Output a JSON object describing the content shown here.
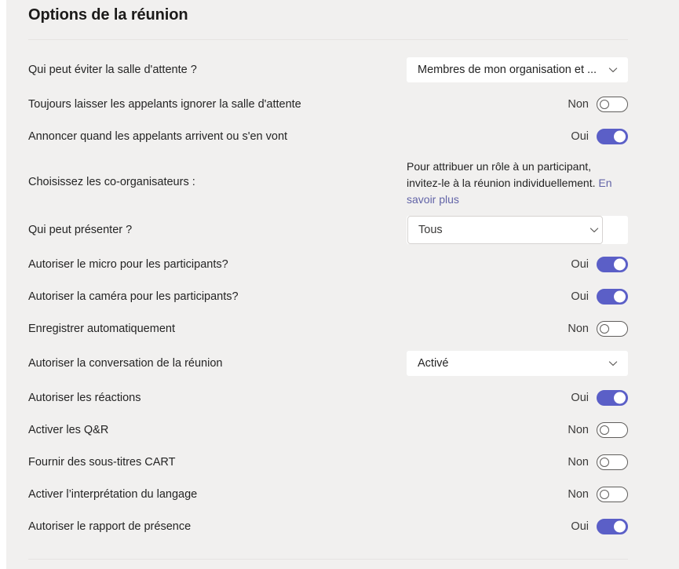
{
  "header": {
    "title": "Options de la réunion"
  },
  "rows": [
    {
      "id": "bypass-lobby",
      "label": "Qui peut éviter la salle d'attente ?",
      "control": "dropdown-flat",
      "value": "Membres de mon organisation et ...",
      "icon": "chevron-down-icon"
    },
    {
      "id": "always-let-callers-bypass",
      "label": "Toujours laisser les appelants ignorer la salle d'attente",
      "control": "toggle",
      "state": "Non",
      "on": false
    },
    {
      "id": "announce-callers",
      "label": "Annoncer quand les appelants arrivent ou s'en vont",
      "control": "toggle",
      "state": "Oui",
      "on": true
    },
    {
      "id": "choose-co-organizers",
      "label": "Choisissez les co-organisateurs :",
      "control": "info",
      "info_text": "Pour attribuer un rôle à un participant, invitez-le à la réunion individuellement. ",
      "info_link": "En savoir plus"
    },
    {
      "id": "who-can-present",
      "label": "Qui peut présenter ?",
      "control": "dropdown-bordered",
      "value": "Tous",
      "icon": "chevron-down-icon"
    },
    {
      "id": "allow-mic",
      "label": "Autoriser le micro pour les participants?",
      "control": "toggle",
      "state": "Oui",
      "on": true
    },
    {
      "id": "allow-camera",
      "label": "Autoriser la caméra pour les participants?",
      "control": "toggle",
      "state": "Oui",
      "on": true
    },
    {
      "id": "record-automatically",
      "label": "Enregistrer automatiquement",
      "control": "toggle",
      "state": "Non",
      "on": false
    },
    {
      "id": "allow-meeting-chat",
      "label": "Autoriser la conversation de la réunion",
      "control": "dropdown-flat",
      "value": "Activé",
      "icon": "chevron-down-icon"
    },
    {
      "id": "allow-reactions",
      "label": "Autoriser les réactions",
      "control": "toggle",
      "state": "Oui",
      "on": true
    },
    {
      "id": "enable-qa",
      "label": "Activer les Q&R",
      "control": "toggle",
      "state": "Non",
      "on": false
    },
    {
      "id": "cart-captions",
      "label": "Fournir des sous-titres CART",
      "control": "toggle",
      "state": "Non",
      "on": false
    },
    {
      "id": "language-interpretation",
      "label": "Activer l’interprétation du langage",
      "control": "toggle",
      "state": "Non",
      "on": false
    },
    {
      "id": "attendance-report",
      "label": "Autoriser le rapport de présence",
      "control": "toggle",
      "state": "Oui",
      "on": true
    }
  ],
  "colors": {
    "background": "#f1f0ef",
    "accent": "#5b5fc7",
    "link": "#6264a7",
    "text": "#242424",
    "divider": "#e6e4e2"
  }
}
